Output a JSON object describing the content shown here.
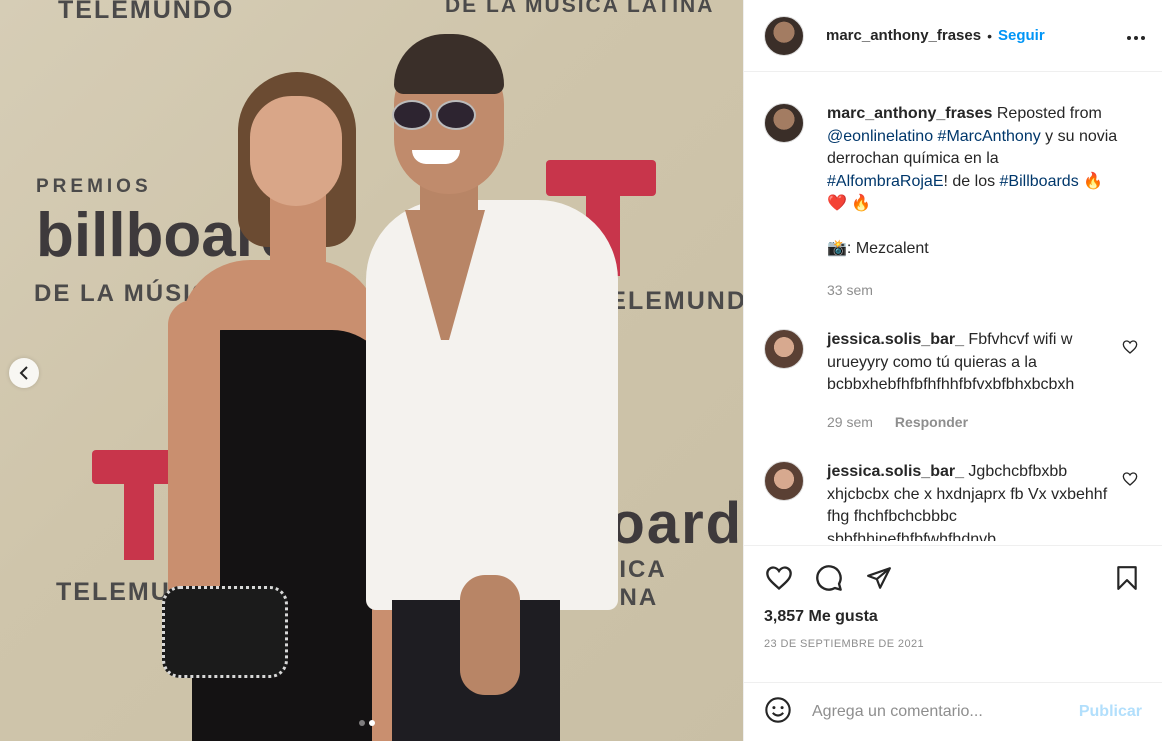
{
  "media": {
    "backdrop": {
      "telemundo_top": "TELEMUNDO",
      "musica_top": "DE LA MÚSICA LATINA",
      "premios": "PREMIOS",
      "billboard": "billboard",
      "de_la_musica": "DE LA MÚSICA",
      "telemundo_right": "TELEMUNDO",
      "telemundo_bottom": "TELEMUNDO",
      "board": "board",
      "musica_latina": "MÚSICA LATINA"
    },
    "prev_icon": "chevron-left-icon",
    "carousel": {
      "count": 2,
      "active_index": 2
    }
  },
  "header": {
    "username": "marc_anthony_frases",
    "separator": "•",
    "follow_label": "Seguir",
    "more_icon": "more-horizontal-icon",
    "more_label": "•••"
  },
  "caption": {
    "username": "marc_anthony_frases",
    "text_1": " Reposted from ",
    "mention": "@eonlinelatino",
    "space_1": " ",
    "hashtag_1": "#MarcAnthony",
    "text_2": " y su novia derrochan química en la ",
    "hashtag_2": "#AlfombraRojaE",
    "text_3": "! de los ",
    "hashtag_3": "#Billboards",
    "emoji_line_1": " 🔥",
    "emoji_line_2": "❤️ 🔥",
    "photo_credit": "📸: Mezcalent",
    "time": "33 sem"
  },
  "comments": [
    {
      "username": "jessica.solis_bar_",
      "text": " Fbfvhcvf wifi w urueyyry como tú quieras a la bcbbxhebfhfbfhfhhfbfvxbfbhxbcbxh",
      "time": "29 sem",
      "reply_label": "Responder"
    },
    {
      "username": "jessica.solis_bar_",
      "text": " Jgbchcbfbxbb xhjcbcbx che x hxdnjaprx fb Vx vxbehhf fhg fhchfbchcbbbc sbbfhhjnefhfbfwhfhdnvb"
    }
  ],
  "actions": {
    "like_icon": "heart-icon",
    "comment_icon": "comment-icon",
    "share_icon": "share-icon",
    "save_icon": "bookmark-icon",
    "likes_text": "3,857 Me gusta",
    "date": "23 DE SEPTIEMBRE DE 2021"
  },
  "add_comment": {
    "emoji_icon": "smiley-icon",
    "placeholder": "Agrega un comentario...",
    "publish_label": "Publicar"
  },
  "colors": {
    "link_blue": "#0095f6",
    "hashtag_blue": "#00376b",
    "muted": "#8e8e8e",
    "publish_disabled": "#b2dffc",
    "telemundo_red": "#c8354b"
  }
}
